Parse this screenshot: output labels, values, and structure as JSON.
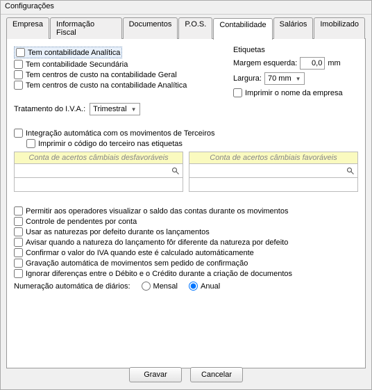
{
  "window_title": "Configurações",
  "tabs": {
    "empresa": "Empresa",
    "infofiscal": "Informação Fiscal",
    "documentos": "Documentos",
    "pos": "P.O.S.",
    "contabilidade": "Contabilidade",
    "salarios": "Salários",
    "imobilizado": "Imobilizado"
  },
  "analytic": {
    "has_analytic": "Tem contabilidade Analítica",
    "has_secondary": "Tem contabilidade Secundária",
    "cost_centers_general": "Tem centros de custo na contabilidade Geral",
    "cost_centers_analytic": "Tem centros de custo na contabilidade Analítica"
  },
  "etiquetas": {
    "title": "Etiquetas",
    "margin_label": "Margem esquerda:",
    "margin_value": "0,0",
    "margin_unit": "mm",
    "width_label": "Largura:",
    "width_value": "70 mm",
    "print_company": "Imprimir o nome da empresa"
  },
  "iva": {
    "label": "Tratamento do I.V.A.:",
    "value": "Trimestral"
  },
  "terceiros": {
    "integration": "Integração automática com os movimentos de Terceiros",
    "print_code_labels": "Imprimir o código do terceiro nas etiquetas",
    "col_unfav": "Conta de acertos câmbiais desfavoráveis",
    "col_fav": "Conta de acertos câmbiais favoráveis"
  },
  "opts": {
    "view_balance": "Permitir aos operadores visualizar o saldo das contas durante os movimentos",
    "pending_control": "Controle de pendentes por conta",
    "default_naturezas": "Usar as naturezas por defeito durante os lançamentos",
    "warn_natureza_diff": "Avisar quando a natureza do lançamento fôr diferente da natureza por defeito",
    "confirm_iva_auto": "Confirmar o valor do IVA quando este é calculado automáticamente",
    "grav_auto": "Gravação automática de movimentos sem pedido de confirmação",
    "ignore_dc_diff": "Ignorar diferenças entre o Débito e o Crédito durante a criação de documentos"
  },
  "numbering": {
    "label": "Numeração automática de diários:",
    "monthly": "Mensal",
    "yearly": "Anual"
  },
  "buttons": {
    "save": "Gravar",
    "cancel": "Cancelar"
  }
}
